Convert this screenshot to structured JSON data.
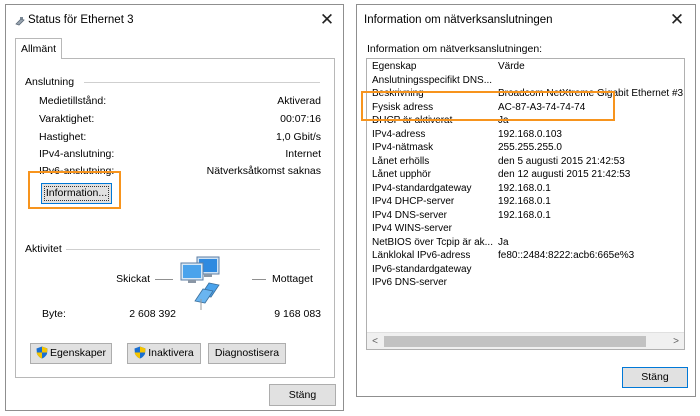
{
  "status_window": {
    "title": "Status för Ethernet 3",
    "tab": "Allmänt",
    "connection_group": "Anslutning",
    "rows": [
      {
        "label": "Medietillstånd:",
        "value": "Aktiverad"
      },
      {
        "label": "Varaktighet:",
        "value": "00:07:16"
      },
      {
        "label": "Hastighet:",
        "value": "1,0 Gbit/s"
      },
      {
        "label": "IPv4-anslutning:",
        "value": "Internet"
      },
      {
        "label": "IPv6-anslutning:",
        "value": "Nätverksåtkomst saknas"
      }
    ],
    "info_button": "Information...",
    "activity_group": "Aktivitet",
    "sent_label": "Skickat",
    "received_label": "Mottaget",
    "bytes_label": "Byte:",
    "bytes_sent": "2 608 392",
    "bytes_received": "9 168 083",
    "properties_button": "Egenskaper",
    "disable_button": "Inaktivera",
    "diagnose_button": "Diagnostisera",
    "close_button": "Stäng",
    "close_glyph": "✕"
  },
  "details_window": {
    "title": "Information om nätverksanslutningen",
    "subheader": "Information om nätverksanslutningen:",
    "columns": {
      "property": "Egenskap",
      "value": "Värde"
    },
    "rows": [
      {
        "property": "Anslutningsspecifikt DNS...",
        "value": ""
      },
      {
        "property": "Beskrivning",
        "value": "Broadcom NetXtreme Gigabit Ethernet #3"
      },
      {
        "property": "Fysisk adress",
        "value": "AC-87-A3-74-74-74"
      },
      {
        "property": "DHCP är aktiverat",
        "value": "Ja"
      },
      {
        "property": "IPv4-adress",
        "value": "192.168.0.103"
      },
      {
        "property": "IPv4-nätmask",
        "value": "255.255.255.0"
      },
      {
        "property": "Lånet erhölls",
        "value": "den 5 augusti 2015 21:42:53"
      },
      {
        "property": "Lånet upphör",
        "value": "den 12 augusti 2015 21:42:53"
      },
      {
        "property": "IPv4-standardgateway",
        "value": "192.168.0.1"
      },
      {
        "property": "IPv4 DHCP-server",
        "value": "192.168.0.1"
      },
      {
        "property": "IPv4 DNS-server",
        "value": "192.168.0.1"
      },
      {
        "property": "IPv4 WINS-server",
        "value": ""
      },
      {
        "property": "NetBIOS över Tcpip är ak...",
        "value": "Ja"
      },
      {
        "property": "Länklokal IPv6-adress",
        "value": "fe80::2484:8222:acb6:665e%3"
      },
      {
        "property": "IPv6-standardgateway",
        "value": ""
      },
      {
        "property": "IPv6 DNS-server",
        "value": ""
      }
    ],
    "scroll_left": "<",
    "scroll_right": ">",
    "close_button": "Stäng",
    "close_glyph": "✕"
  },
  "colors": {
    "highlight": "#f7941d",
    "button_face": "#e1e1e1",
    "focus_border": "#0078d7",
    "shield_blue": "#1a6fd1",
    "shield_yellow": "#f5c400"
  }
}
